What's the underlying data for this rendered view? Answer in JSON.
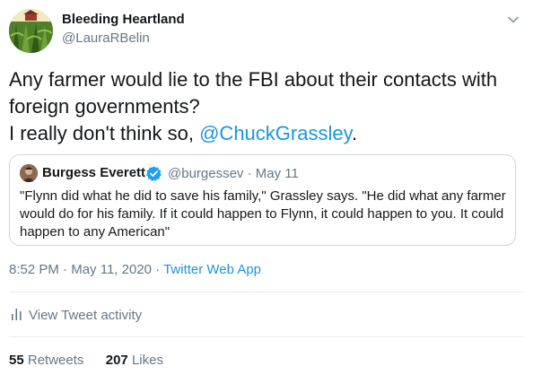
{
  "tweet": {
    "author_name": "Bleeding Heartland",
    "author_handle": "@LauraRBelin",
    "text_before": "Any farmer would lie to the FBI about their contacts with foreign governments?",
    "text_line2": "I really don't think so, ",
    "mention": "@ChuckGrassley",
    "text_after": ".",
    "time": "8:52 PM",
    "date": "May 11, 2020",
    "app": "Twitter Web App",
    "separator": "·"
  },
  "quoted": {
    "author_name": "Burgess Everett",
    "author_handle": "@burgessev",
    "date": "May 11",
    "separator": "·",
    "text": "\"Flynn did what he did to save his family,\" Grassley says. \"He did what any farmer would do for his family. If it could happen to Flynn, it could happen to you. It could happen to any American\""
  },
  "activity": {
    "label": "View Tweet activity"
  },
  "stats": {
    "retweets_count": "55",
    "retweets_label": "Retweets",
    "likes_count": "207",
    "likes_label": "Likes"
  },
  "icons": {
    "menu": "chevron-down-icon",
    "verified": "verified-badge-icon",
    "activity": "bar-chart-icon"
  },
  "colors": {
    "link": "#1b95e0",
    "secondary_text": "#657786",
    "border": "#ccd6dd"
  }
}
